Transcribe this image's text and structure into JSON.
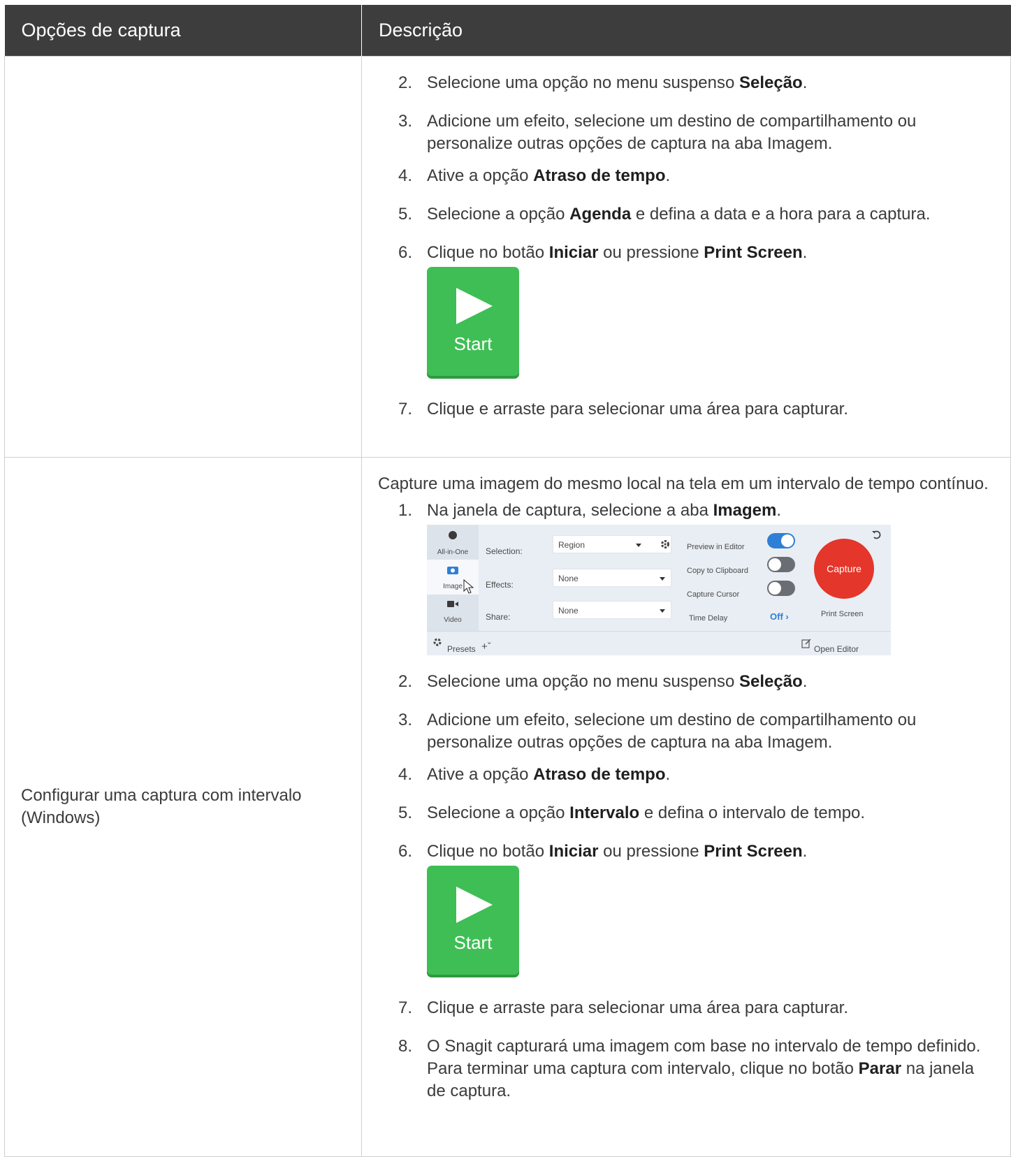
{
  "header": {
    "col1": "Opções de captura",
    "col2": "Descrição"
  },
  "row1": {
    "option": "",
    "steps": [
      {
        "n": "2.",
        "parts": [
          {
            "t": "Selecione uma opção no menu suspenso "
          },
          {
            "t": "Seleção",
            "b": 1
          },
          {
            "t": "."
          }
        ]
      },
      {
        "n": "3.",
        "parts": [
          {
            "t": "Adicione um efeito, selecione um destino de compartilhamento ou personalize outras opções de captura na aba Imagem."
          }
        ]
      },
      {
        "n": "4.",
        "parts": [
          {
            "t": "Ative a opção "
          },
          {
            "t": "Atraso de tempo",
            "b": 1
          },
          {
            "t": "."
          }
        ]
      },
      {
        "n": "5.",
        "parts": [
          {
            "t": "Selecione a opção "
          },
          {
            "t": "Agenda",
            "b": 1
          },
          {
            "t": " e defina a data e a hora para a captura."
          }
        ]
      },
      {
        "n": "6.",
        "parts": [
          {
            "t": "Clique no botão "
          },
          {
            "t": "Iniciar",
            "b": 1
          },
          {
            "t": " ou pressione "
          },
          {
            "t": "Print Screen",
            "b": 1
          },
          {
            "t": "."
          }
        ]
      },
      {
        "n": "7.",
        "parts": [
          {
            "t": "Clique e arraste para selecionar uma área para capturar."
          }
        ]
      }
    ]
  },
  "row2": {
    "option": "Configurar uma captura com intervalo (Windows)",
    "intro": "Capture uma imagem do mesmo local na tela em um intervalo de tempo contínuo.",
    "steps": [
      {
        "n": "1.",
        "parts": [
          {
            "t": "Na janela de captura, selecione a aba "
          },
          {
            "t": "Imagem",
            "b": 1
          },
          {
            "t": "."
          }
        ]
      },
      {
        "n": "2.",
        "parts": [
          {
            "t": "Selecione uma opção no menu suspenso "
          },
          {
            "t": "Seleção",
            "b": 1
          },
          {
            "t": "."
          }
        ]
      },
      {
        "n": "3.",
        "parts": [
          {
            "t": "Adicione um efeito, selecione um destino de compartilhamento ou personalize outras opções de captura na aba Imagem."
          }
        ]
      },
      {
        "n": "4.",
        "parts": [
          {
            "t": "Ative a opção "
          },
          {
            "t": "Atraso de tempo",
            "b": 1
          },
          {
            "t": "."
          }
        ]
      },
      {
        "n": "5.",
        "parts": [
          {
            "t": "Selecione a opção "
          },
          {
            "t": "Intervalo",
            "b": 1
          },
          {
            "t": " e defina o intervalo de tempo."
          }
        ]
      },
      {
        "n": "6.",
        "parts": [
          {
            "t": "Clique no botão "
          },
          {
            "t": "Iniciar",
            "b": 1
          },
          {
            "t": " ou pressione "
          },
          {
            "t": "Print Screen",
            "b": 1
          },
          {
            "t": "."
          }
        ]
      },
      {
        "n": "7.",
        "parts": [
          {
            "t": "Clique e arraste para selecionar uma área para capturar."
          }
        ]
      },
      {
        "n": "8.",
        "parts": [
          {
            "t": "O Snagit capturará uma imagem com base no intervalo de tempo definido. Para terminar uma captura com intervalo, clique no botão "
          },
          {
            "t": "Parar",
            "b": 1
          },
          {
            "t": " na janela de captura."
          }
        ]
      }
    ]
  },
  "start_button": {
    "label": "Start",
    "color": "#3fbe55"
  },
  "capture_window": {
    "tabs": {
      "all_in_one": "All-in-One",
      "image": "Image",
      "video": "Video"
    },
    "selection_label": "Selection:",
    "selection_value": "Region",
    "effects_label": "Effects:",
    "effects_value": "None",
    "share_label": "Share:",
    "share_value": "None",
    "preview_label": "Preview in Editor",
    "clipboard_label": "Copy to Clipboard",
    "cursor_label": "Capture Cursor",
    "time_delay_label": "Time Delay",
    "time_delay_value": "Off",
    "capture_label": "Capture",
    "print_screen": "Print Screen",
    "presets": "Presets",
    "open_editor": "Open Editor",
    "toggles": {
      "preview": true,
      "clipboard": false,
      "cursor": false
    },
    "capture_color": "#e4362a",
    "accent": "#2f7fd6"
  }
}
